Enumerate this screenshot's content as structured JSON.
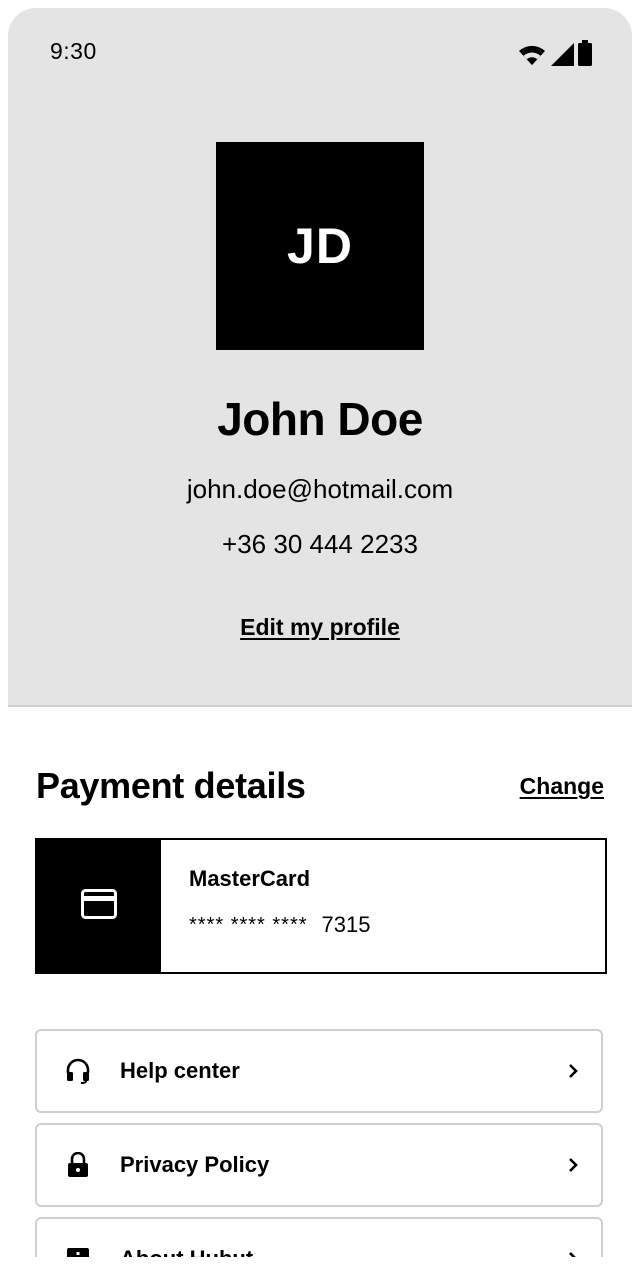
{
  "status_bar": {
    "time": "9:30",
    "icons": [
      "wifi-icon",
      "signal-icon",
      "battery-icon"
    ]
  },
  "profile": {
    "initials": "JD",
    "name": "John Doe",
    "email": "john.doe@hotmail.com",
    "phone": "+36 30 444 2233",
    "edit_label": "Edit my profile"
  },
  "payment": {
    "title": "Payment details",
    "change_label": "Change",
    "card": {
      "icon": "credit-card-icon",
      "brand": "MasterCard",
      "mask": "**** **** ****",
      "last4": "7315"
    }
  },
  "menu": {
    "items": [
      {
        "label": "Help center",
        "icon": "headset-icon"
      },
      {
        "label": "Privacy Policy",
        "icon": "lock-icon"
      },
      {
        "label": "About Hubut",
        "icon": "info-icon"
      }
    ]
  },
  "colors": {
    "profile_background": "#e4e4e4",
    "accent": "#000000",
    "border": "#cfcfcf"
  }
}
